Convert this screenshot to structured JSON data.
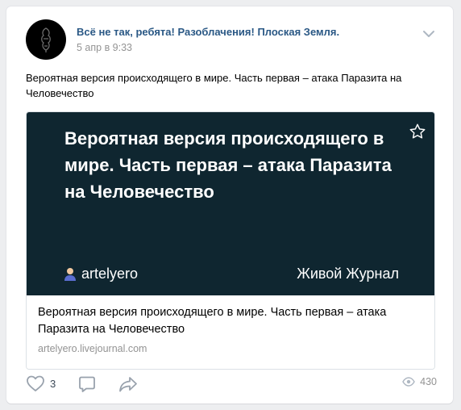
{
  "post": {
    "group_name": "Всё не так, ребята! Разоблачения! Плоская Земля.",
    "date": "5 апр в 9:33",
    "text": "Вероятная версия происходящего в мире. Часть первая – атака Паразита на Человечество"
  },
  "link_card": {
    "image_title": "Вероятная версия происходящего в мире. Часть первая – атака Паразита на Человечество",
    "author": "artelyero",
    "source": "Живой Журнал",
    "title": "Вероятная версия происходящего в мире. Часть первая – атака Паразита на Человечество",
    "domain": "artelyero.livejournal.com",
    "image_bg": "#0f2630"
  },
  "actions": {
    "like_count": "3",
    "views_count": "430"
  },
  "icons": {
    "menu": "chevron-down-icon",
    "bookmark": "star-icon",
    "author": "person-icon",
    "like": "heart-icon",
    "comment": "comment-icon",
    "share": "share-icon",
    "views": "eye-icon"
  },
  "colors": {
    "link": "#2a5885",
    "muted": "#939393",
    "page_bg": "#edeef0"
  }
}
